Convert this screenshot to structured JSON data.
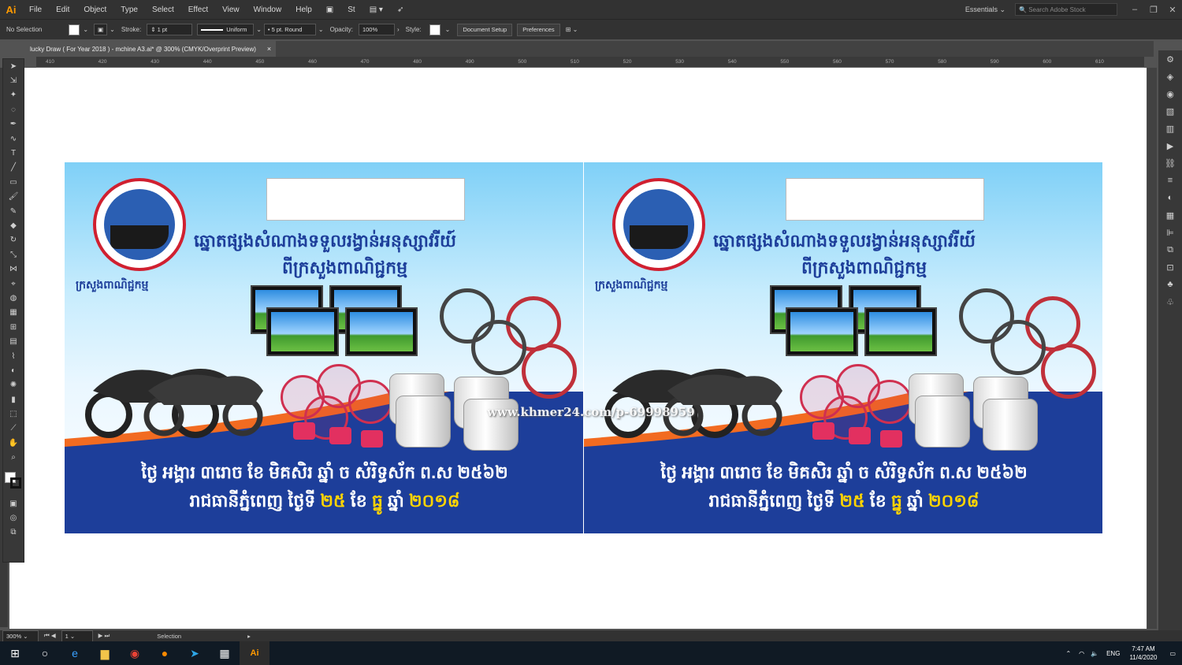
{
  "app": {
    "logo_text": "Ai",
    "menu": [
      "File",
      "Edit",
      "Object",
      "Type",
      "Select",
      "Effect",
      "View",
      "Window",
      "Help"
    ],
    "workspace": "Essentials",
    "search_placeholder": "Search Adobe Stock"
  },
  "control_bar": {
    "selection": "No Selection",
    "stroke_label": "Stroke:",
    "stroke_weight": "1 pt",
    "stroke_profile": "Uniform",
    "brush": "5 pt. Round",
    "opacity_label": "Opacity:",
    "opacity_value": "100%",
    "style_label": "Style:",
    "document_setup": "Document Setup",
    "preferences": "Preferences"
  },
  "document_tab": {
    "title": "lucky Draw ( For Year 2018 ) - mchine A3.ai* @ 300% (CMYK/Overprint Preview)",
    "close": "×"
  },
  "ruler_ticks": [
    "410",
    "420",
    "430",
    "440",
    "450",
    "460",
    "470",
    "480",
    "490",
    "500",
    "510",
    "520",
    "530",
    "540",
    "550",
    "560",
    "570",
    "580",
    "590",
    "600",
    "610"
  ],
  "banner": {
    "title_line1": "ឆ្នោតផ្សងសំណាងទទួលរង្វាន់អនុស្សាវរីយ៍",
    "title_line2": "ពីក្រសួងពាណិជ្ជកម្ម",
    "ministry_caption": "ក្រសួងពាណិជ្ជកម្ម",
    "date_line1": "ថ្ងៃ អង្គារ ៣រោច ខែ មិគសិរ ឆ្នាំ ច សំរិទ្ធស័ក ព.ស ២៥៦២",
    "date_line2_prefix": "រាជធានីភ្នំពេញ ថ្ងៃទី",
    "date_day": "២៥",
    "date_month_label": "ខែ",
    "date_month": "ធ្នូ",
    "date_year_label": "ឆ្នាំ",
    "date_year": "២០១៨"
  },
  "watermark": "www.khmer24.com/p-69998959",
  "status": {
    "zoom": "300%",
    "page": "1",
    "tool": "Selection"
  },
  "taskbar": {
    "lang": "ENG",
    "time": "7:47 AM",
    "date": "11/4/2020"
  },
  "colors": {
    "brand_blue": "#1d3e9a",
    "accent_orange": "#f26b21",
    "highlight_yellow": "#ffd400"
  }
}
